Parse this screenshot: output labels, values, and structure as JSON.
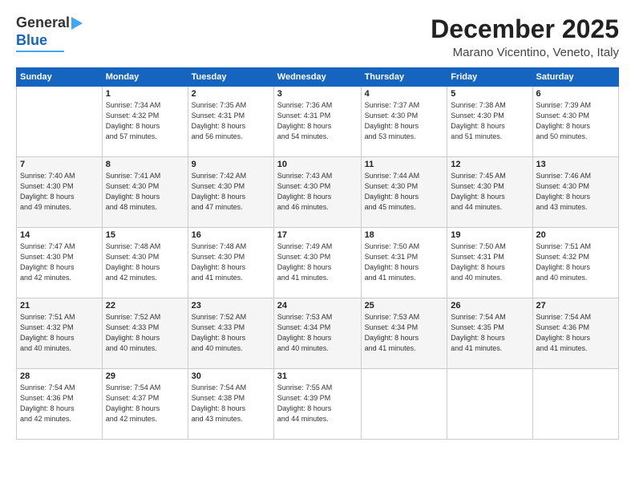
{
  "logo": {
    "general": "General",
    "blue": "Blue"
  },
  "header": {
    "month": "December 2025",
    "location": "Marano Vicentino, Veneto, Italy"
  },
  "days_header": [
    "Sunday",
    "Monday",
    "Tuesday",
    "Wednesday",
    "Thursday",
    "Friday",
    "Saturday"
  ],
  "weeks": [
    [
      {
        "day": "",
        "sunrise": "",
        "sunset": "",
        "daylight": ""
      },
      {
        "day": "1",
        "sunrise": "Sunrise: 7:34 AM",
        "sunset": "Sunset: 4:32 PM",
        "daylight": "Daylight: 8 hours and 57 minutes."
      },
      {
        "day": "2",
        "sunrise": "Sunrise: 7:35 AM",
        "sunset": "Sunset: 4:31 PM",
        "daylight": "Daylight: 8 hours and 56 minutes."
      },
      {
        "day": "3",
        "sunrise": "Sunrise: 7:36 AM",
        "sunset": "Sunset: 4:31 PM",
        "daylight": "Daylight: 8 hours and 54 minutes."
      },
      {
        "day": "4",
        "sunrise": "Sunrise: 7:37 AM",
        "sunset": "Sunset: 4:30 PM",
        "daylight": "Daylight: 8 hours and 53 minutes."
      },
      {
        "day": "5",
        "sunrise": "Sunrise: 7:38 AM",
        "sunset": "Sunset: 4:30 PM",
        "daylight": "Daylight: 8 hours and 51 minutes."
      },
      {
        "day": "6",
        "sunrise": "Sunrise: 7:39 AM",
        "sunset": "Sunset: 4:30 PM",
        "daylight": "Daylight: 8 hours and 50 minutes."
      }
    ],
    [
      {
        "day": "7",
        "sunrise": "Sunrise: 7:40 AM",
        "sunset": "Sunset: 4:30 PM",
        "daylight": "Daylight: 8 hours and 49 minutes."
      },
      {
        "day": "8",
        "sunrise": "Sunrise: 7:41 AM",
        "sunset": "Sunset: 4:30 PM",
        "daylight": "Daylight: 8 hours and 48 minutes."
      },
      {
        "day": "9",
        "sunrise": "Sunrise: 7:42 AM",
        "sunset": "Sunset: 4:30 PM",
        "daylight": "Daylight: 8 hours and 47 minutes."
      },
      {
        "day": "10",
        "sunrise": "Sunrise: 7:43 AM",
        "sunset": "Sunset: 4:30 PM",
        "daylight": "Daylight: 8 hours and 46 minutes."
      },
      {
        "day": "11",
        "sunrise": "Sunrise: 7:44 AM",
        "sunset": "Sunset: 4:30 PM",
        "daylight": "Daylight: 8 hours and 45 minutes."
      },
      {
        "day": "12",
        "sunrise": "Sunrise: 7:45 AM",
        "sunset": "Sunset: 4:30 PM",
        "daylight": "Daylight: 8 hours and 44 minutes."
      },
      {
        "day": "13",
        "sunrise": "Sunrise: 7:46 AM",
        "sunset": "Sunset: 4:30 PM",
        "daylight": "Daylight: 8 hours and 43 minutes."
      }
    ],
    [
      {
        "day": "14",
        "sunrise": "Sunrise: 7:47 AM",
        "sunset": "Sunset: 4:30 PM",
        "daylight": "Daylight: 8 hours and 42 minutes."
      },
      {
        "day": "15",
        "sunrise": "Sunrise: 7:48 AM",
        "sunset": "Sunset: 4:30 PM",
        "daylight": "Daylight: 8 hours and 42 minutes."
      },
      {
        "day": "16",
        "sunrise": "Sunrise: 7:48 AM",
        "sunset": "Sunset: 4:30 PM",
        "daylight": "Daylight: 8 hours and 41 minutes."
      },
      {
        "day": "17",
        "sunrise": "Sunrise: 7:49 AM",
        "sunset": "Sunset: 4:30 PM",
        "daylight": "Daylight: 8 hours and 41 minutes."
      },
      {
        "day": "18",
        "sunrise": "Sunrise: 7:50 AM",
        "sunset": "Sunset: 4:31 PM",
        "daylight": "Daylight: 8 hours and 41 minutes."
      },
      {
        "day": "19",
        "sunrise": "Sunrise: 7:50 AM",
        "sunset": "Sunset: 4:31 PM",
        "daylight": "Daylight: 8 hours and 40 minutes."
      },
      {
        "day": "20",
        "sunrise": "Sunrise: 7:51 AM",
        "sunset": "Sunset: 4:32 PM",
        "daylight": "Daylight: 8 hours and 40 minutes."
      }
    ],
    [
      {
        "day": "21",
        "sunrise": "Sunrise: 7:51 AM",
        "sunset": "Sunset: 4:32 PM",
        "daylight": "Daylight: 8 hours and 40 minutes."
      },
      {
        "day": "22",
        "sunrise": "Sunrise: 7:52 AM",
        "sunset": "Sunset: 4:33 PM",
        "daylight": "Daylight: 8 hours and 40 minutes."
      },
      {
        "day": "23",
        "sunrise": "Sunrise: 7:52 AM",
        "sunset": "Sunset: 4:33 PM",
        "daylight": "Daylight: 8 hours and 40 minutes."
      },
      {
        "day": "24",
        "sunrise": "Sunrise: 7:53 AM",
        "sunset": "Sunset: 4:34 PM",
        "daylight": "Daylight: 8 hours and 40 minutes."
      },
      {
        "day": "25",
        "sunrise": "Sunrise: 7:53 AM",
        "sunset": "Sunset: 4:34 PM",
        "daylight": "Daylight: 8 hours and 41 minutes."
      },
      {
        "day": "26",
        "sunrise": "Sunrise: 7:54 AM",
        "sunset": "Sunset: 4:35 PM",
        "daylight": "Daylight: 8 hours and 41 minutes."
      },
      {
        "day": "27",
        "sunrise": "Sunrise: 7:54 AM",
        "sunset": "Sunset: 4:36 PM",
        "daylight": "Daylight: 8 hours and 41 minutes."
      }
    ],
    [
      {
        "day": "28",
        "sunrise": "Sunrise: 7:54 AM",
        "sunset": "Sunset: 4:36 PM",
        "daylight": "Daylight: 8 hours and 42 minutes."
      },
      {
        "day": "29",
        "sunrise": "Sunrise: 7:54 AM",
        "sunset": "Sunset: 4:37 PM",
        "daylight": "Daylight: 8 hours and 42 minutes."
      },
      {
        "day": "30",
        "sunrise": "Sunrise: 7:54 AM",
        "sunset": "Sunset: 4:38 PM",
        "daylight": "Daylight: 8 hours and 43 minutes."
      },
      {
        "day": "31",
        "sunrise": "Sunrise: 7:55 AM",
        "sunset": "Sunset: 4:39 PM",
        "daylight": "Daylight: 8 hours and 44 minutes."
      },
      {
        "day": "",
        "sunrise": "",
        "sunset": "",
        "daylight": ""
      },
      {
        "day": "",
        "sunrise": "",
        "sunset": "",
        "daylight": ""
      },
      {
        "day": "",
        "sunrise": "",
        "sunset": "",
        "daylight": ""
      }
    ]
  ]
}
